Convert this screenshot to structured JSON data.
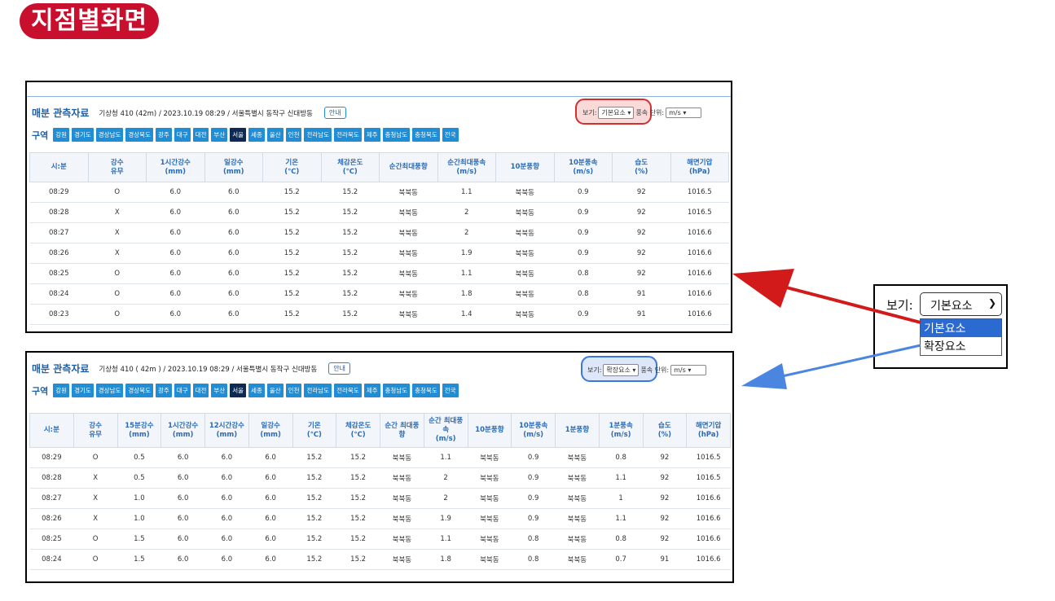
{
  "page_title": "지점별화면",
  "colors": {
    "title_bg": "#c8102e",
    "accent_blue": "#1f8ed6",
    "active_chip": "#0d2a55",
    "red_arrow": "#d31a1a",
    "blue_arrow": "#4a86e0"
  },
  "header": {
    "title": "매분 관측자료",
    "info_top": "기상청 410 (42m) / 2023.10.19 08:29 / 서울특별시 동작구 신대방동",
    "info_bottom": "기상청 410 ( 42m ) / 2023.10.19 08:29 / 서울특별시 동작구 신대방동",
    "guide_button": "안내",
    "view_label": "보기:",
    "view_value_basic": "기본요소",
    "view_value_extended": "확장요소",
    "wind_unit_label": "풍속 단위:",
    "wind_unit_value": "m/s"
  },
  "regions": {
    "label": "구역",
    "items": [
      "강원",
      "경기도",
      "경상남도",
      "경상북도",
      "광주",
      "대구",
      "대전",
      "부산",
      "서울",
      "세종",
      "울산",
      "인천",
      "전라남도",
      "전라북도",
      "제주",
      "충청남도",
      "충청북도",
      "전국"
    ],
    "active": "서울"
  },
  "basic_table": {
    "headers": [
      "시:분",
      "강수\n유무",
      "1시간강수\n(mm)",
      "일강수\n(mm)",
      "기온\n(℃)",
      "체감온도\n(℃)",
      "순간최대풍향",
      "순간최대풍속\n(m/s)",
      "10분풍향",
      "10분풍속\n(m/s)",
      "습도\n(%)",
      "해면기압\n(hPa)"
    ],
    "rows": [
      [
        "08:29",
        "O",
        "6.0",
        "6.0",
        "15.2",
        "15.2",
        "북북동",
        "1.1",
        "북북동",
        "0.9",
        "92",
        "1016.5"
      ],
      [
        "08:28",
        "X",
        "6.0",
        "6.0",
        "15.2",
        "15.2",
        "북북동",
        "2",
        "북북동",
        "0.9",
        "92",
        "1016.5"
      ],
      [
        "08:27",
        "X",
        "6.0",
        "6.0",
        "15.2",
        "15.2",
        "북북동",
        "2",
        "북북동",
        "0.9",
        "92",
        "1016.6"
      ],
      [
        "08:26",
        "X",
        "6.0",
        "6.0",
        "15.2",
        "15.2",
        "북북동",
        "1.9",
        "북북동",
        "0.9",
        "92",
        "1016.6"
      ],
      [
        "08:25",
        "O",
        "6.0",
        "6.0",
        "15.2",
        "15.2",
        "북북동",
        "1.1",
        "북북동",
        "0.8",
        "92",
        "1016.6"
      ],
      [
        "08:24",
        "O",
        "6.0",
        "6.0",
        "15.2",
        "15.2",
        "북북동",
        "1.8",
        "북북동",
        "0.8",
        "91",
        "1016.6"
      ],
      [
        "08:23",
        "O",
        "6.0",
        "6.0",
        "15.2",
        "15.2",
        "북북동",
        "1.4",
        "북북동",
        "0.9",
        "91",
        "1016.6"
      ]
    ]
  },
  "extended_table": {
    "headers": [
      "시:분",
      "강수\n유무",
      "15분강수\n(mm)",
      "1시간강수\n(mm)",
      "12시간강수\n(mm)",
      "일강수\n(mm)",
      "기온\n(℃)",
      "체감온도\n(℃)",
      "순간 최대풍\n향",
      "순간 최대풍\n속\n(m/s)",
      "10분풍향",
      "10분풍속\n(m/s)",
      "1분풍향",
      "1분풍속\n(m/s)",
      "습도\n(%)",
      "해면기압\n(hPa)"
    ],
    "rows": [
      [
        "08:29",
        "O",
        "0.5",
        "6.0",
        "6.0",
        "6.0",
        "15.2",
        "15.2",
        "북북동",
        "1.1",
        "북북동",
        "0.9",
        "북북동",
        "0.8",
        "92",
        "1016.5"
      ],
      [
        "08:28",
        "X",
        "0.5",
        "6.0",
        "6.0",
        "6.0",
        "15.2",
        "15.2",
        "북북동",
        "2",
        "북북동",
        "0.9",
        "북북동",
        "1.1",
        "92",
        "1016.5"
      ],
      [
        "08:27",
        "X",
        "1.0",
        "6.0",
        "6.0",
        "6.0",
        "15.2",
        "15.2",
        "북북동",
        "2",
        "북북동",
        "0.9",
        "북북동",
        "1",
        "92",
        "1016.6"
      ],
      [
        "08:26",
        "X",
        "1.0",
        "6.0",
        "6.0",
        "6.0",
        "15.2",
        "15.2",
        "북북동",
        "1.9",
        "북북동",
        "0.9",
        "북북동",
        "1.1",
        "92",
        "1016.6"
      ],
      [
        "08:25",
        "O",
        "1.5",
        "6.0",
        "6.0",
        "6.0",
        "15.2",
        "15.2",
        "북북동",
        "1.1",
        "북북동",
        "0.8",
        "북북동",
        "0.8",
        "92",
        "1016.6"
      ],
      [
        "08:24",
        "O",
        "1.5",
        "6.0",
        "6.0",
        "6.0",
        "15.2",
        "15.2",
        "북북동",
        "1.8",
        "북북동",
        "0.8",
        "북북동",
        "0.7",
        "91",
        "1016.6"
      ]
    ]
  },
  "zoom_dropdown": {
    "label": "보기:",
    "selected": "기본요소",
    "options": [
      "기본요소",
      "확장요소"
    ],
    "highlighted": "기본요소"
  }
}
